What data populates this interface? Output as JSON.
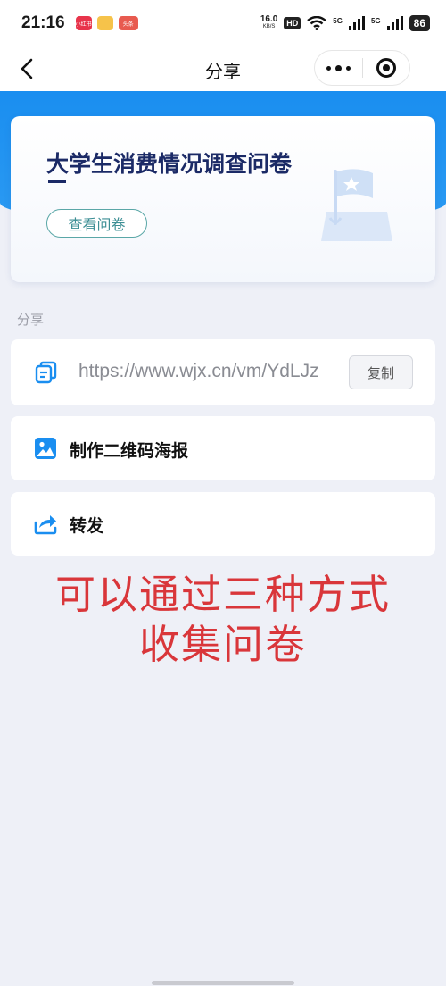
{
  "status_bar": {
    "time": "21:16",
    "app_badges": [
      "小红书",
      "",
      "头条"
    ],
    "net_speed_value": "16.0",
    "net_speed_unit": "KB/S",
    "hd_label": "HD",
    "signal_1_label": "5G",
    "signal_2_label": "5G",
    "battery": "86"
  },
  "nav": {
    "title": "分享"
  },
  "survey": {
    "title": "大学生消费情况调查问卷",
    "view_button": "查看问卷"
  },
  "share": {
    "section_label": "分享",
    "link_url": "https://www.wjx.cn/vm/YdLJz",
    "copy_button": "复制",
    "qr_poster_label": "制作二维码海报",
    "forward_label": "转发"
  },
  "overlay": {
    "line1": "可以通过三种方式",
    "line2": "收集问卷"
  },
  "colors": {
    "brand_blue": "#1a8ef0",
    "title_navy": "#1b2a66",
    "overlay_red": "#d9363a"
  }
}
